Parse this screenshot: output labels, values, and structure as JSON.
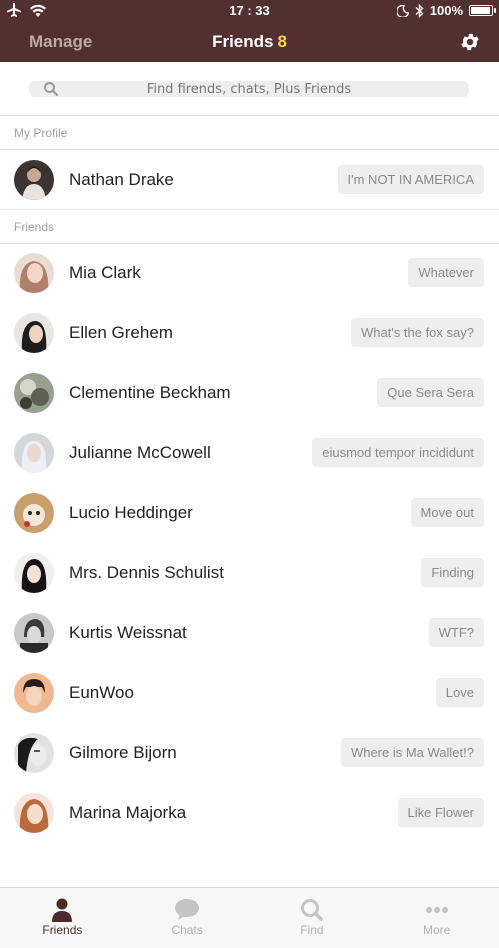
{
  "status_bar": {
    "time": "17 : 33",
    "battery": "100%",
    "battery_level": 1.0
  },
  "nav": {
    "left_label": "Manage",
    "title": "Friends",
    "count": "8"
  },
  "search": {
    "placeholder": "Find firends, chats, Plus Friends"
  },
  "sections": {
    "profile": "My Profile",
    "friends": "Friends"
  },
  "profile": {
    "name": "Nathan Drake",
    "status": "I'm NOT IN AMERICA"
  },
  "friends": [
    {
      "name": "Mia Clark",
      "status": "Whatever"
    },
    {
      "name": "Ellen Grehem",
      "status": "What's the fox say?"
    },
    {
      "name": "Clementine Beckham",
      "status": "Que Sera Sera"
    },
    {
      "name": "Julianne McCowell",
      "status": "eiusmod tempor incididunt"
    },
    {
      "name": "Lucio Heddinger",
      "status": "Move out"
    },
    {
      "name": "Mrs. Dennis Schulist",
      "status": "Finding"
    },
    {
      "name": "Kurtis Weissnat",
      "status": "WTF?"
    },
    {
      "name": "EunWoo",
      "status": "Love"
    },
    {
      "name": "Gilmore Bijorn",
      "status": "Where is Ma Wallet!?"
    },
    {
      "name": "Marina Majorka",
      "status": "Like Flower"
    }
  ],
  "tabs": [
    {
      "label": "Friends",
      "icon": "person-icon",
      "active": true
    },
    {
      "label": "Chats",
      "icon": "chat-bubble-icon",
      "active": false
    },
    {
      "label": "Find",
      "icon": "search-icon",
      "active": false
    },
    {
      "label": "More",
      "icon": "more-dots-icon",
      "active": false
    }
  ],
  "colors": {
    "header": "#523030",
    "count_accent": "#ffd54a",
    "tab_active": "#4a2a2a"
  }
}
